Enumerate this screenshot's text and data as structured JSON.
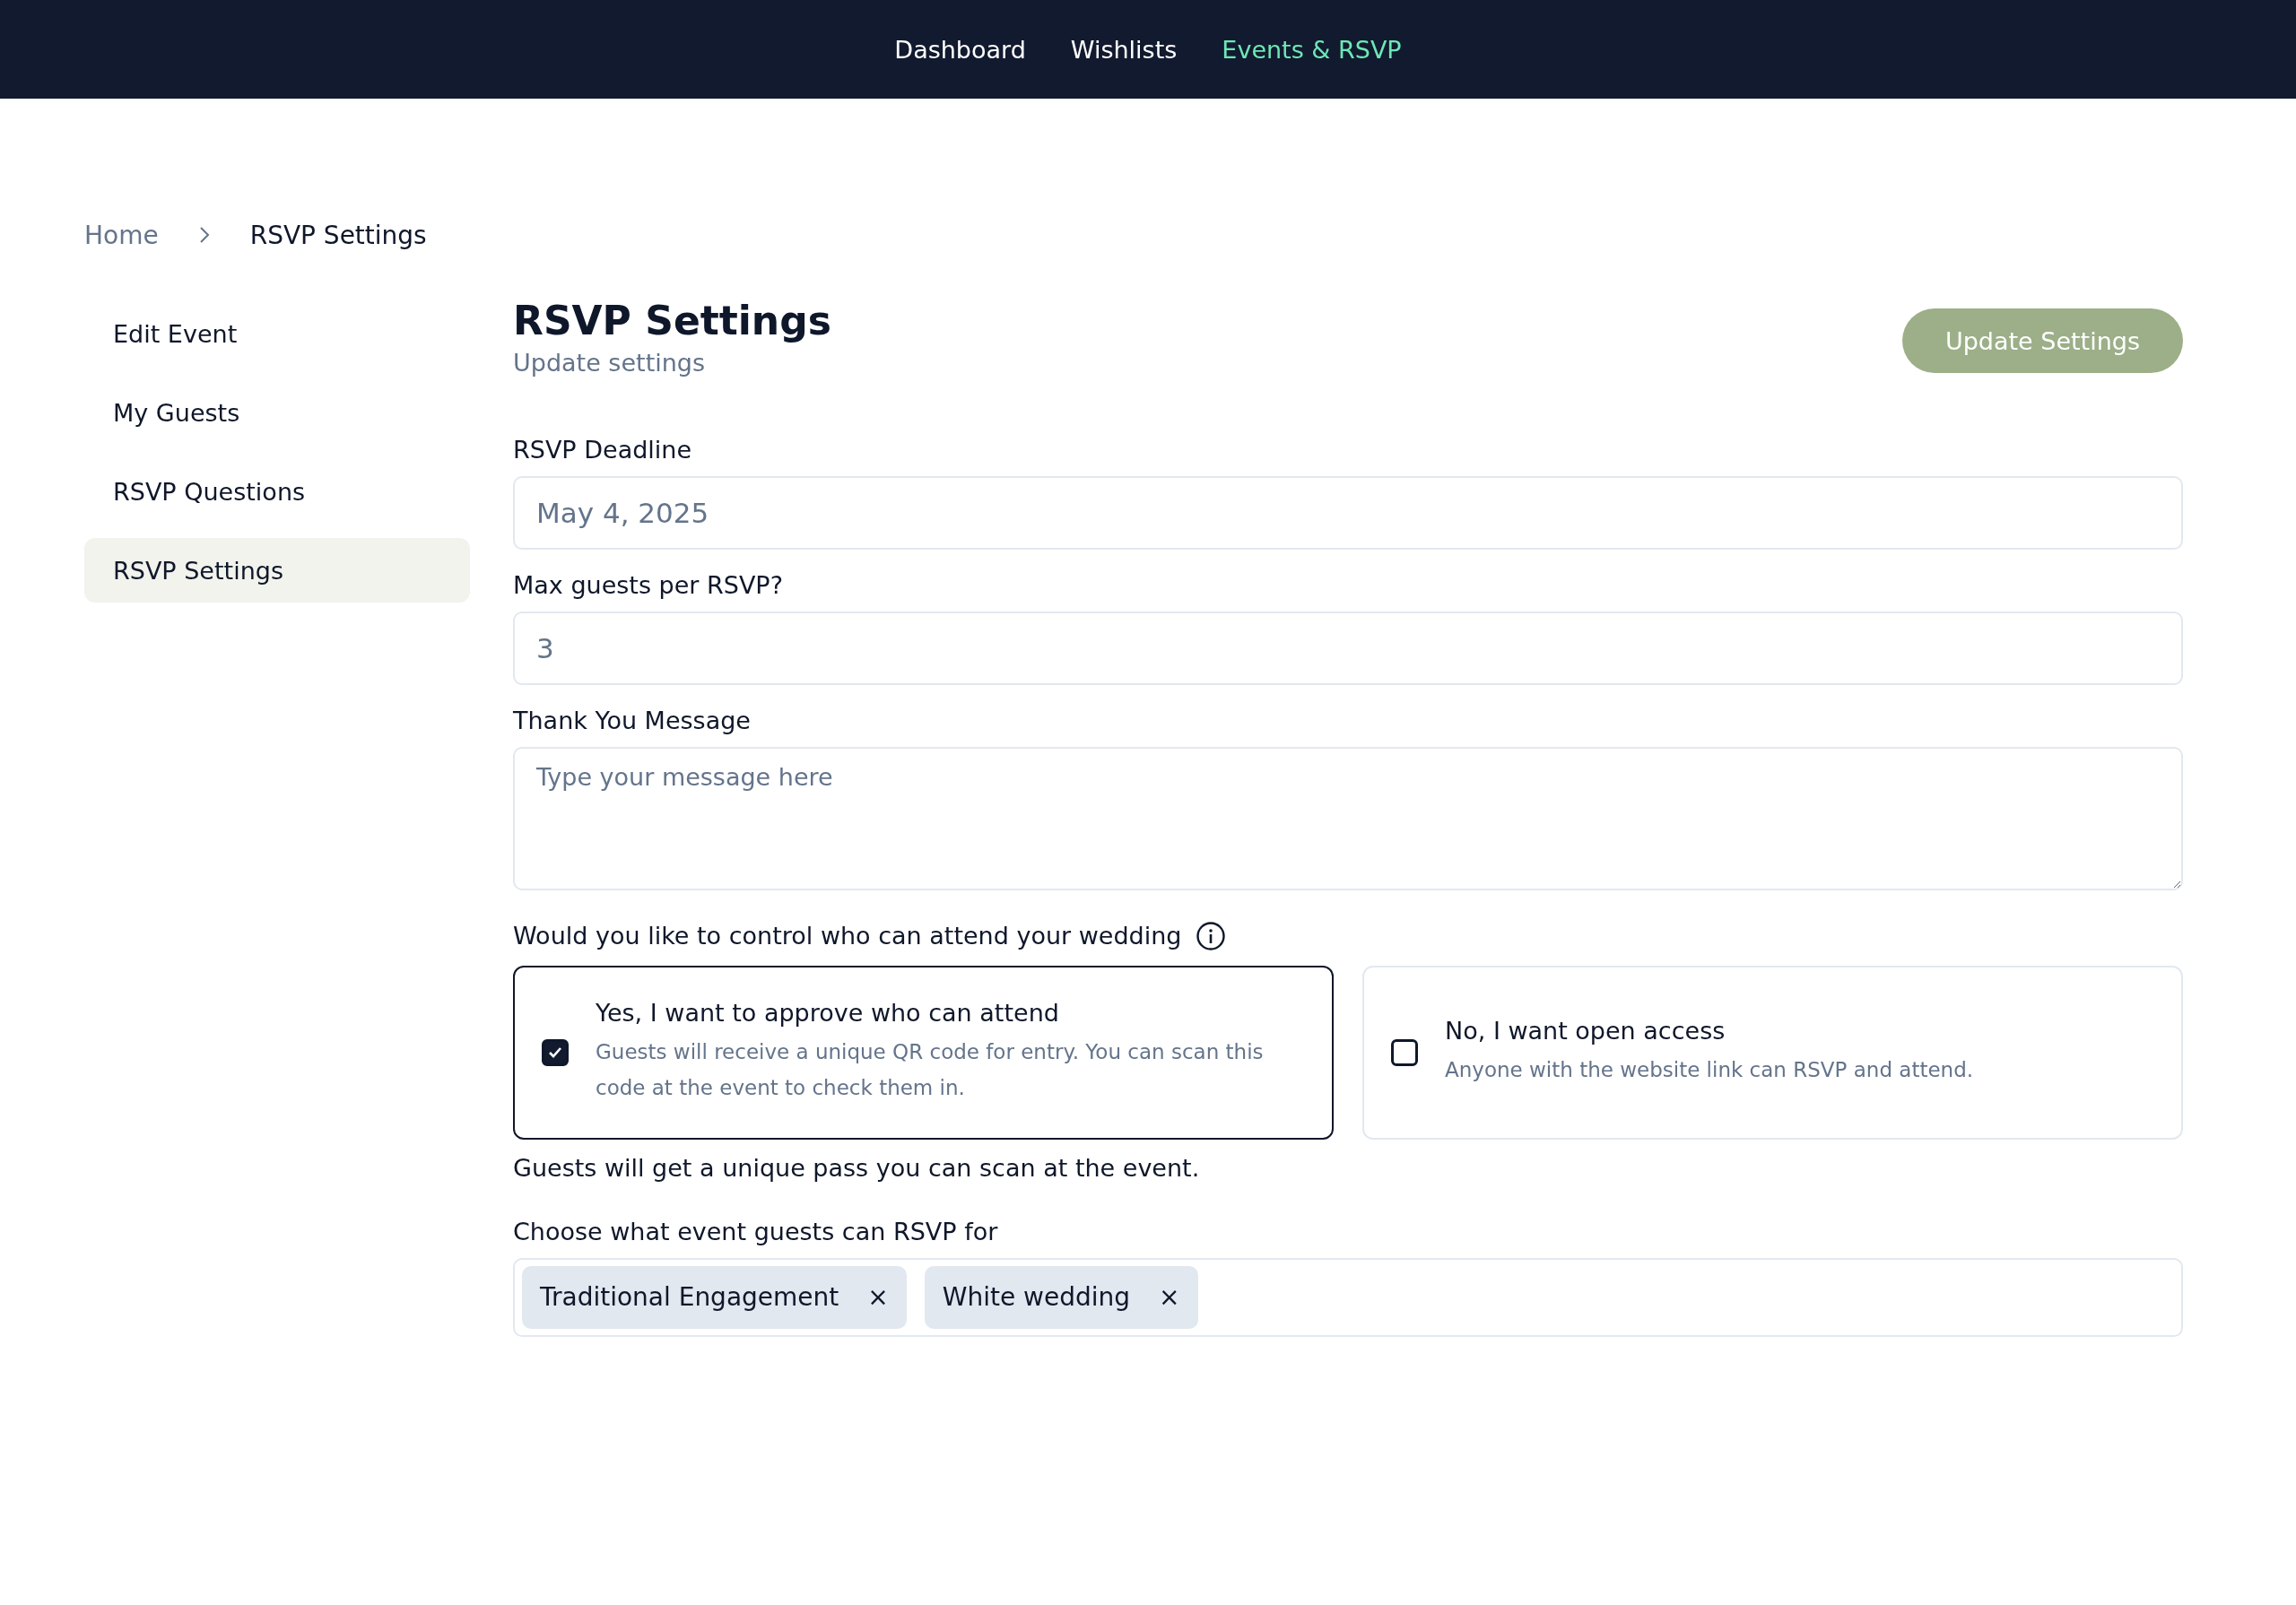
{
  "nav": [
    {
      "label": "Dashboard",
      "selected": false
    },
    {
      "label": "Wishlists",
      "selected": false
    },
    {
      "label": "Events & RSVP",
      "selected": true
    }
  ],
  "breadcrumb": [
    "Home",
    "RSVP Settings"
  ],
  "sidebar": {
    "items": [
      {
        "label": "Edit Event",
        "selected": false
      },
      {
        "label": "My Guests",
        "selected": false
      },
      {
        "label": "RSVP Questions",
        "selected": false
      },
      {
        "label": "RSVP Settings",
        "selected": true
      }
    ]
  },
  "header": {
    "title": "RSVP Settings",
    "subtitle": "Update settings",
    "button": "Update Settings"
  },
  "fields": [
    {
      "kind": "input",
      "label": "RSVP Deadline",
      "value": "May 4, 2025"
    },
    {
      "kind": "input",
      "label": "Max guests per RSVP?",
      "value": "3"
    },
    {
      "kind": "textarea",
      "label": "Thank You Message",
      "placeholder": "Type your message here"
    }
  ],
  "access": {
    "question": "Would you like to control who can attend your wedding",
    "options": [
      {
        "title": "Yes, I want to approve who can attend",
        "description": "Guests will receive a unique QR code for entry. You can scan this code at the event to check them in.",
        "checked": true
      },
      {
        "title": "No, I want open access",
        "description": "Anyone with the website link can RSVP and attend.",
        "checked": false
      }
    ],
    "note": "Guests will get a unique pass you can scan at the event."
  },
  "events": {
    "label": "Choose what event guests can RSVP for",
    "tags": [
      {
        "label": "Traditional Engagement",
        "remove": "×"
      },
      {
        "label": "White wedding",
        "remove": "×"
      }
    ]
  }
}
